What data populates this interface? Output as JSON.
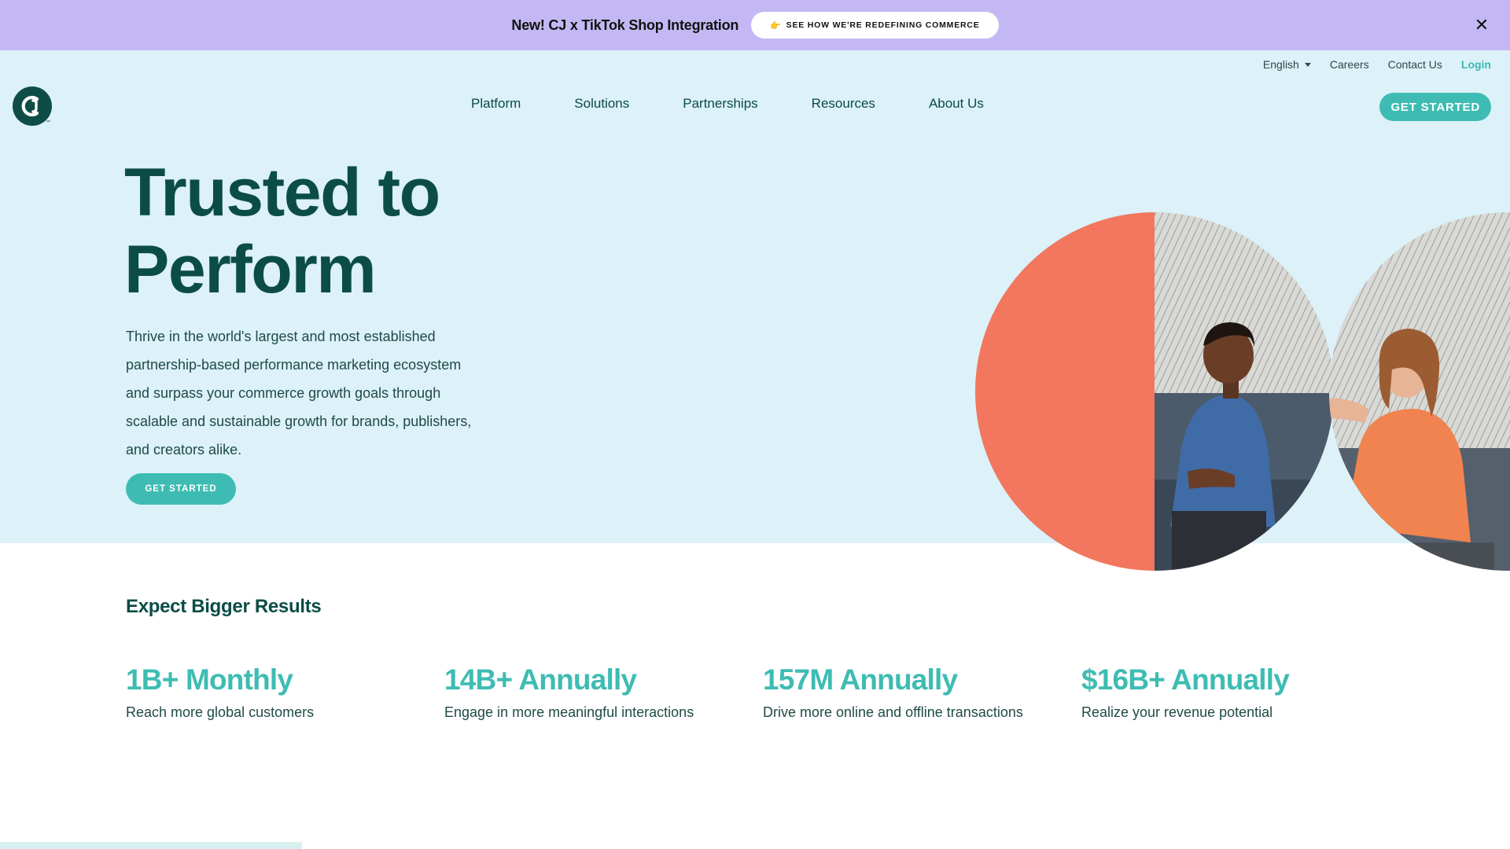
{
  "announcement": {
    "text": "New! CJ x TikTok Shop Integration",
    "button_label": "SEE HOW WE'RE REDEFINING COMMERCE",
    "button_emoji": "👉",
    "close_glyph": "✕"
  },
  "utility_nav": {
    "language": "English",
    "careers": "Careers",
    "contact": "Contact Us",
    "login": "Login"
  },
  "main_nav": {
    "items": [
      {
        "label": "Platform"
      },
      {
        "label": "Solutions"
      },
      {
        "label": "Partnerships"
      },
      {
        "label": "Resources"
      },
      {
        "label": "About Us"
      }
    ],
    "cta": "GET STARTED"
  },
  "logo": {
    "tm": "™"
  },
  "hero": {
    "title_line1": "Trusted to",
    "title_line2": "Perform",
    "body": "Thrive in the world's largest and most established partnership-based performance marketing ecosystem and surpass your commerce growth goals through scalable and sustainable growth for brands, publishers, and creators alike.",
    "cta": "GET STARTED"
  },
  "results": {
    "title": "Expect Bigger Results",
    "stats": [
      {
        "value": "1B+ Monthly",
        "desc": "Reach more global customers"
      },
      {
        "value": "14B+ Annually",
        "desc": "Engage in more meaningful interactions"
      },
      {
        "value": "157M Annually",
        "desc": "Drive more online and offline transactions"
      },
      {
        "value": "$16B+ Annually",
        "desc": "Realize your revenue potential"
      }
    ]
  },
  "colors": {
    "announcement_bg": "#c4b8f4",
    "hero_bg": "#dcf1f8",
    "brand_dark": "#0b4d46",
    "accent_teal": "#3ebcb3",
    "coral": "#f2775e"
  }
}
